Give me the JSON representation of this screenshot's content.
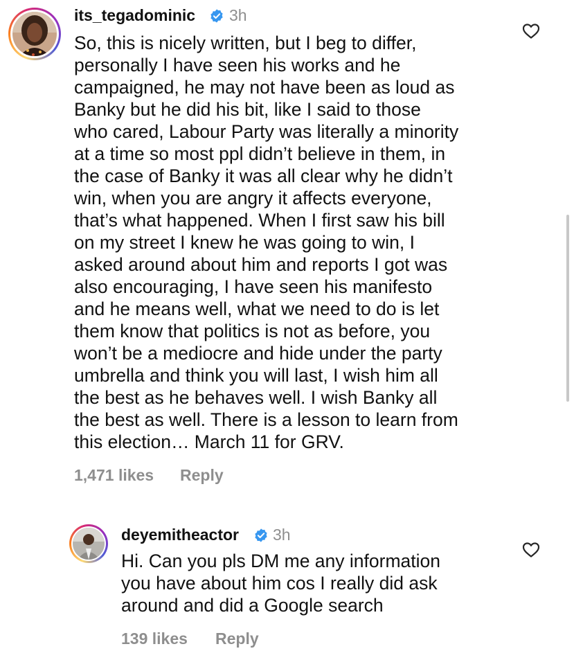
{
  "comments": [
    {
      "username": "its_tegadominic",
      "time": "3h",
      "lines": [
        "So, this is nicely written, but I beg to differ,",
        "personally I have seen his works and he",
        "campaigned, he may not have been as loud as",
        "Banky but he did his bit, like I said to those",
        "who cared, Labour Party was literally a minority",
        "at a time so most ppl didn’t believe in them, in",
        "the case of Banky it was all clear why he didn’t",
        "win, when you are angry it affects everyone,",
        "that’s what happened. When I first saw his bill",
        "on my street I knew he was going to win, I",
        "asked around about him and reports I got was",
        "also encouraging, I have seen his manifesto",
        "and he means well, what we need to do is let",
        "them know that politics is not as before, you",
        "won’t be a mediocre and hide under the party",
        "umbrella and think you will last, I wish him all",
        "the best as he behaves well. I wish Banky all",
        "the best as well. There is a lesson to learn from",
        "this election… March 11 for GRV."
      ],
      "likes": "1,471 likes",
      "reply_label": "Reply"
    },
    {
      "username": "deyemitheactor",
      "time": "3h",
      "lines": [
        "Hi. Can you pls DM me any information",
        "you have about him cos I really did ask",
        "around and did a Google search"
      ],
      "likes": "139 likes",
      "reply_label": "Reply"
    }
  ],
  "icons": {
    "verified": "verified-badge-icon",
    "like": "heart-icon"
  },
  "colors": {
    "verified_blue": "#3797f0",
    "muted_text": "#8e8e8e",
    "text": "#111111"
  }
}
